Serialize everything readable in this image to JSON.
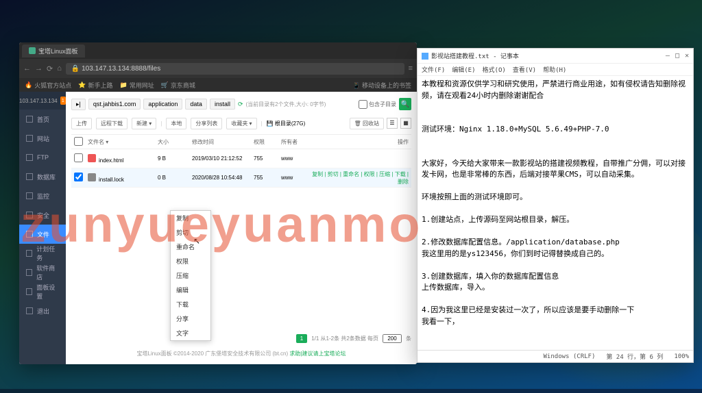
{
  "browser": {
    "tab_title": "宝塔Linux面板",
    "url": "103.147.13.134:8888/files",
    "bookmarks": [
      "火狐官方站点",
      "新手上路",
      "常用网址",
      "京东商城"
    ]
  },
  "sidebar": {
    "ip": "103.147.13.134",
    "badge": "1",
    "items": [
      {
        "label": "首页"
      },
      {
        "label": "网站"
      },
      {
        "label": "FTP"
      },
      {
        "label": "数据库"
      },
      {
        "label": "监控"
      },
      {
        "label": "安全"
      },
      {
        "label": "文件"
      },
      {
        "label": "计划任务"
      },
      {
        "label": "软件商店"
      },
      {
        "label": "面板设置"
      },
      {
        "label": "退出"
      }
    ],
    "active": 6
  },
  "breadcrumb": {
    "root_icon": "▸|",
    "segs": [
      "qst.jahbis1.com",
      "application",
      "data",
      "install"
    ],
    "info": "(当前目录有2个文件,大小: 0字节)",
    "sub_dir": "包含子目录"
  },
  "toolbar": {
    "upload": "上传",
    "remote": "远程下载",
    "newfile": "新建 ▾",
    "local": "本地",
    "share": "分享列表",
    "fav": "收藏夹 ▾",
    "disk": "根目录(27G)",
    "recycle": "回收站"
  },
  "columns": {
    "name": "文件名 ▾",
    "size": "大小",
    "time": "修改时间",
    "perm": "权限",
    "owner": "所有者",
    "ops": "操作"
  },
  "files": [
    {
      "name": "index.html",
      "size": "9 B",
      "time": "2019/03/10 21:12:52",
      "perm": "755",
      "owner": "www",
      "ops": ""
    },
    {
      "name": "install.lock",
      "size": "0 B",
      "time": "2020/08/28 10:54:48",
      "perm": "755",
      "owner": "www",
      "ops": "复制 | 剪切 | 重命名 | 权限 | 压缩 | 下载 | 删除"
    }
  ],
  "context_menu": [
    "复制",
    "剪切",
    "重命名",
    "权限",
    "压缩",
    "编辑",
    "下载",
    "分享",
    "文字"
  ],
  "pager": {
    "page": "1",
    "info": "1/1  从1-2条  共2条数据  每页",
    "per": "200",
    "unit": "条"
  },
  "footer": {
    "left": "宝塔Linux面板 ©2014-2020 广东堡塔安全技术有限公司 (bt.cn)",
    "right": "求助|建议请上宝塔论坛"
  },
  "notepad": {
    "title": "影视站搭建教程.txt - 记事本",
    "menu": [
      "文件(F)",
      "编辑(E)",
      "格式(O)",
      "查看(V)",
      "帮助(H)"
    ],
    "body": "本教程和资源仅供学习和研究使用，严禁进行商业用途，如有侵权请告知删除视频，请在观看24小时内删除谢谢配合\n\n\n测试环境：Nginx 1.18.0+MySQL 5.6.49+PHP-7.0\n\n\n大家好，今天给大家带来一款影视站的搭建视频教程，自带推广分佣，可以对接发卡网，也是非常棒的东西，后端对接苹果CMS，可以自动采集。\n\n环境按照上面的测试环境即可。\n\n1.创建站点，上传源码至网站根目录，解压。\n\n2.修改数据库配置信息。/application/database.php\n我这里用的是ys123456，你们到时记得替换成自己的。\n\n3.创建数据库，填入你的数据库配置信息\n上传数据库，导入。\n\n4.因为我这里已经是安装过一次了，所以应该是要手动删除一下\n我看一下，",
    "status": {
      "enc": "Windows (CRLF)",
      "pos": "第 24 行，第 6 列",
      "zoom": "100%"
    }
  },
  "watermark": "zunyueyuanmo"
}
